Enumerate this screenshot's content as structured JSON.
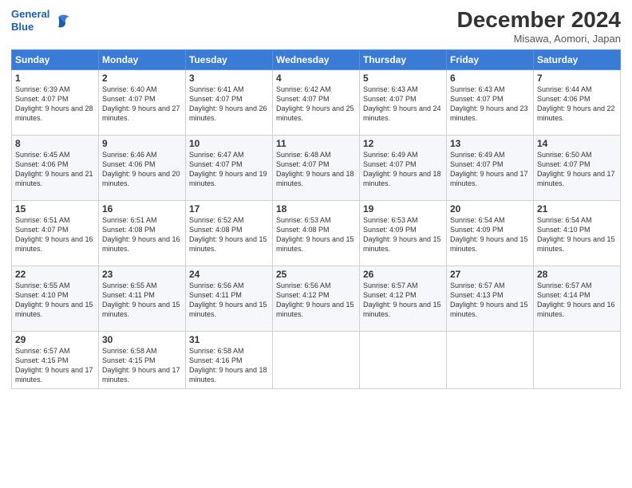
{
  "header": {
    "logo_line1": "General",
    "logo_line2": "Blue",
    "month_title": "December 2024",
    "subtitle": "Misawa, Aomori, Japan"
  },
  "days_of_week": [
    "Sunday",
    "Monday",
    "Tuesday",
    "Wednesday",
    "Thursday",
    "Friday",
    "Saturday"
  ],
  "weeks": [
    [
      {
        "day": "1",
        "sunrise": "6:39 AM",
        "sunset": "4:07 PM",
        "daylight": "9 hours and 28 minutes."
      },
      {
        "day": "2",
        "sunrise": "6:40 AM",
        "sunset": "4:07 PM",
        "daylight": "9 hours and 27 minutes."
      },
      {
        "day": "3",
        "sunrise": "6:41 AM",
        "sunset": "4:07 PM",
        "daylight": "9 hours and 26 minutes."
      },
      {
        "day": "4",
        "sunrise": "6:42 AM",
        "sunset": "4:07 PM",
        "daylight": "9 hours and 25 minutes."
      },
      {
        "day": "5",
        "sunrise": "6:43 AM",
        "sunset": "4:07 PM",
        "daylight": "9 hours and 24 minutes."
      },
      {
        "day": "6",
        "sunrise": "6:43 AM",
        "sunset": "4:07 PM",
        "daylight": "9 hours and 23 minutes."
      },
      {
        "day": "7",
        "sunrise": "6:44 AM",
        "sunset": "4:06 PM",
        "daylight": "9 hours and 22 minutes."
      }
    ],
    [
      {
        "day": "8",
        "sunrise": "6:45 AM",
        "sunset": "4:06 PM",
        "daylight": "9 hours and 21 minutes."
      },
      {
        "day": "9",
        "sunrise": "6:46 AM",
        "sunset": "4:06 PM",
        "daylight": "9 hours and 20 minutes."
      },
      {
        "day": "10",
        "sunrise": "6:47 AM",
        "sunset": "4:07 PM",
        "daylight": "9 hours and 19 minutes."
      },
      {
        "day": "11",
        "sunrise": "6:48 AM",
        "sunset": "4:07 PM",
        "daylight": "9 hours and 18 minutes."
      },
      {
        "day": "12",
        "sunrise": "6:49 AM",
        "sunset": "4:07 PM",
        "daylight": "9 hours and 18 minutes."
      },
      {
        "day": "13",
        "sunrise": "6:49 AM",
        "sunset": "4:07 PM",
        "daylight": "9 hours and 17 minutes."
      },
      {
        "day": "14",
        "sunrise": "6:50 AM",
        "sunset": "4:07 PM",
        "daylight": "9 hours and 17 minutes."
      }
    ],
    [
      {
        "day": "15",
        "sunrise": "6:51 AM",
        "sunset": "4:07 PM",
        "daylight": "9 hours and 16 minutes."
      },
      {
        "day": "16",
        "sunrise": "6:51 AM",
        "sunset": "4:08 PM",
        "daylight": "9 hours and 16 minutes."
      },
      {
        "day": "17",
        "sunrise": "6:52 AM",
        "sunset": "4:08 PM",
        "daylight": "9 hours and 15 minutes."
      },
      {
        "day": "18",
        "sunrise": "6:53 AM",
        "sunset": "4:08 PM",
        "daylight": "9 hours and 15 minutes."
      },
      {
        "day": "19",
        "sunrise": "6:53 AM",
        "sunset": "4:09 PM",
        "daylight": "9 hours and 15 minutes."
      },
      {
        "day": "20",
        "sunrise": "6:54 AM",
        "sunset": "4:09 PM",
        "daylight": "9 hours and 15 minutes."
      },
      {
        "day": "21",
        "sunrise": "6:54 AM",
        "sunset": "4:10 PM",
        "daylight": "9 hours and 15 minutes."
      }
    ],
    [
      {
        "day": "22",
        "sunrise": "6:55 AM",
        "sunset": "4:10 PM",
        "daylight": "9 hours and 15 minutes."
      },
      {
        "day": "23",
        "sunrise": "6:55 AM",
        "sunset": "4:11 PM",
        "daylight": "9 hours and 15 minutes."
      },
      {
        "day": "24",
        "sunrise": "6:56 AM",
        "sunset": "4:11 PM",
        "daylight": "9 hours and 15 minutes."
      },
      {
        "day": "25",
        "sunrise": "6:56 AM",
        "sunset": "4:12 PM",
        "daylight": "9 hours and 15 minutes."
      },
      {
        "day": "26",
        "sunrise": "6:57 AM",
        "sunset": "4:12 PM",
        "daylight": "9 hours and 15 minutes."
      },
      {
        "day": "27",
        "sunrise": "6:57 AM",
        "sunset": "4:13 PM",
        "daylight": "9 hours and 15 minutes."
      },
      {
        "day": "28",
        "sunrise": "6:57 AM",
        "sunset": "4:14 PM",
        "daylight": "9 hours and 16 minutes."
      }
    ],
    [
      {
        "day": "29",
        "sunrise": "6:57 AM",
        "sunset": "4:15 PM",
        "daylight": "9 hours and 17 minutes."
      },
      {
        "day": "30",
        "sunrise": "6:58 AM",
        "sunset": "4:15 PM",
        "daylight": "9 hours and 17 minutes."
      },
      {
        "day": "31",
        "sunrise": "6:58 AM",
        "sunset": "4:16 PM",
        "daylight": "9 hours and 18 minutes."
      },
      null,
      null,
      null,
      null
    ]
  ]
}
